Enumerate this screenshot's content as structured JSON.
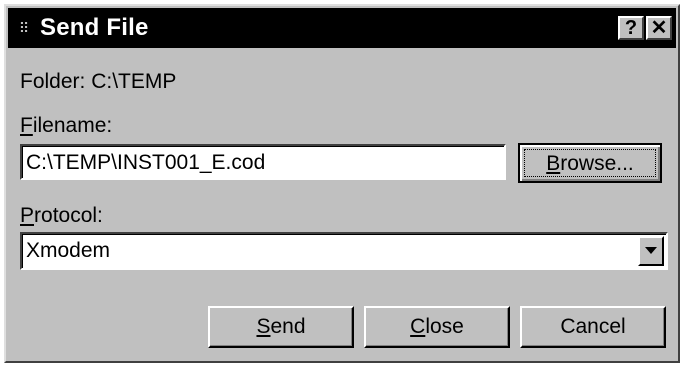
{
  "window": {
    "title": "Send File",
    "help_label": "?",
    "close_label": "✕"
  },
  "folder": {
    "label": "Folder:",
    "value": "C:\\TEMP"
  },
  "filename": {
    "label_accel": "F",
    "label_rest": "ilename:",
    "value": "C:\\TEMP\\INST001_E.cod"
  },
  "browse": {
    "accel": "B",
    "rest": "rowse..."
  },
  "protocol": {
    "label_accel": "P",
    "label_rest": "rotocol:",
    "value": "Xmodem"
  },
  "buttons": {
    "send_accel": "S",
    "send_rest": "end",
    "close_accel": "C",
    "close_rest": "lose",
    "cancel": "Cancel"
  },
  "icons": {
    "system_menu": "grip-dots-icon",
    "help": "question-mark-icon",
    "close": "close-x-icon",
    "dropdown": "chevron-down-icon"
  },
  "colors": {
    "dialog_face": "#c0c0c0",
    "titlebar": "#000000",
    "title_text": "#ffffff"
  }
}
